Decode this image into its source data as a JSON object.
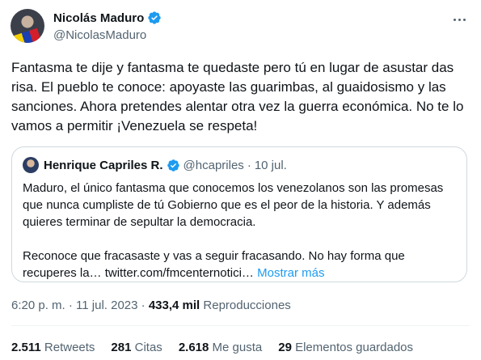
{
  "author": {
    "name": "Nicolás Maduro",
    "handle": "@NicolasMaduro"
  },
  "tweet": {
    "text": "Fantasma te dije y fantasma te quedaste pero tú en lugar de asustar das risa. El pueblo te conoce: apoyaste las guarimbas, al guaidosismo y las sanciones. Ahora pretendes alentar otra vez la guerra económica. No te lo vamos a permitir ¡Venezuela se respeta!"
  },
  "quote": {
    "name": "Henrique Capriles R.",
    "handle": "@hcapriles",
    "separator": "·",
    "date": "10 jul.",
    "paragraph1": "Maduro, el único fantasma que conocemos los venezolanos son las promesas que nunca cumpliste de tú Gobierno que es el peor de la historia. Y además quieres terminar de sepultar la democracia.",
    "paragraph2": "Reconoce que fracasaste y vas a seguir fracasando. No hay forma que recuperes la… twitter.com/fmcenternotici…",
    "show_more": "Mostrar más"
  },
  "meta": {
    "time_date": "6:20 p. m. · 11 jul. 2023 ·",
    "views": "433,4 mil",
    "views_label": "Reproducciones"
  },
  "stats": [
    {
      "value": "2.511",
      "label": "Retweets"
    },
    {
      "value": "281",
      "label": "Citas"
    },
    {
      "value": "2.618",
      "label": "Me gusta"
    },
    {
      "value": "29",
      "label": "Elementos guardados"
    }
  ],
  "colors": {
    "verified": "#1d9bf0",
    "link": "#1d9bf0",
    "secondary_text": "#536471",
    "border": "#cfd9de"
  },
  "icons": {
    "verified": "verified-badge-icon",
    "more": "more-options-icon"
  }
}
